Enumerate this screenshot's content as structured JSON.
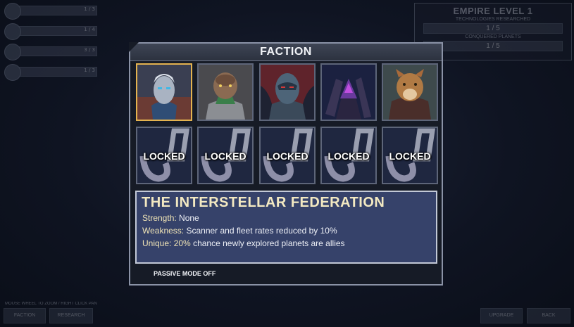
{
  "hud": {
    "resources": [
      {
        "icon": "resource-icon",
        "value": "1 / 3"
      },
      {
        "icon": "resource-icon",
        "value": "1 / 4"
      },
      {
        "icon": "resource-icon",
        "value": "3 / 3"
      },
      {
        "icon": "resource-icon",
        "value": "1 / 3"
      }
    ],
    "empire": {
      "title": "EMPIRE LEVEL 1",
      "tech_label": "TECHNOLOGIES RESEARCHED",
      "tech_value": "1 / 5",
      "planets_label": "CONQUERED PLANETS",
      "planets_value": "1 / 5"
    },
    "hint": "MOUSE WHEEL TO ZOOM / RIGHT CLICK PAN",
    "buttons": {
      "faction": "FACTION",
      "research": "RESEARCH",
      "upgrade": "UPGRADE",
      "back": "BACK"
    }
  },
  "modal": {
    "title": "FACTION",
    "factions": [
      {
        "icon": "federation-portrait-icon",
        "selected": true
      },
      {
        "icon": "reptilian-portrait-icon",
        "selected": false
      },
      {
        "icon": "robot-portrait-icon",
        "selected": false
      },
      {
        "icon": "insectoid-portrait-icon",
        "selected": false
      },
      {
        "icon": "feline-portrait-icon",
        "selected": false
      }
    ],
    "locked": [
      "LOCKED",
      "LOCKED",
      "LOCKED",
      "LOCKED",
      "LOCKED"
    ],
    "info": {
      "name": "THE INTERSTELLAR FEDERATION",
      "strength_label": "Strength:",
      "strength_value": " None",
      "weakness_label": "Weakness:",
      "weakness_value": " Scanner and fleet rates reduced by 10%",
      "unique_label": "Unique:",
      "unique_highlight": " 20%",
      "unique_value": " chance newly explored planets are allies"
    },
    "passive_mode": "PASSIVE MODE OFF"
  },
  "colors": {
    "selected_border": "#e4b34f",
    "info_bg": "#36426a",
    "title_text": "#f3e9c2"
  }
}
